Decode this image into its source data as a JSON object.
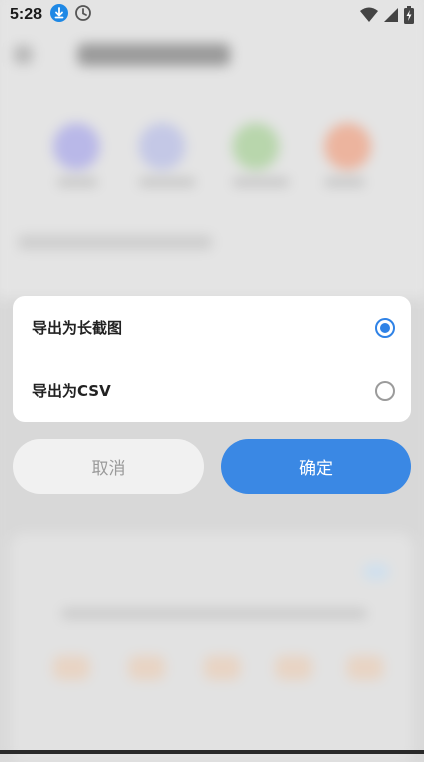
{
  "status_bar": {
    "time": "5:28",
    "left_icons": [
      "download-icon",
      "clock-icon"
    ],
    "right_icons": [
      "wifi-icon",
      "cellular-signal-icon",
      "battery-charging-icon"
    ],
    "accent_color": "#1e88e5"
  },
  "dialog": {
    "options": [
      {
        "label": "导出为长截图",
        "selected": true
      },
      {
        "label": "导出为CSV",
        "selected": false
      }
    ],
    "radio_color": "#2f82e6"
  },
  "buttons": {
    "cancel_label": "取消",
    "confirm_label": "确定",
    "confirm_color": "#3a88e4"
  }
}
